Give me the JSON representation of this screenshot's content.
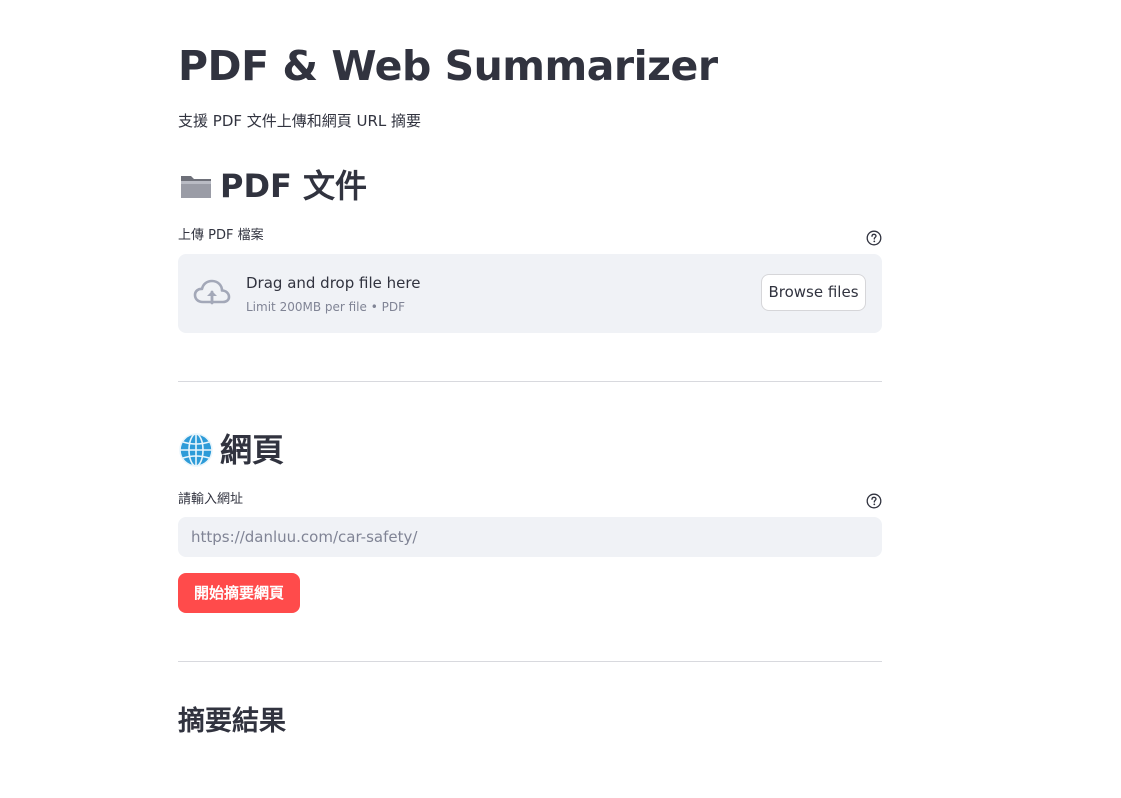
{
  "app": {
    "title": "PDF & Web Summarizer",
    "subtitle": "支援 PDF 文件上傳和網頁 URL 摘要"
  },
  "pdf_section": {
    "header": "PDF 文件",
    "icon": "folder-icon",
    "upload_label": "上傳 PDF 檔案",
    "dropzone": {
      "title": "Drag and drop file here",
      "limit": "Limit 200MB per file • PDF",
      "browse_label": "Browse files"
    }
  },
  "web_section": {
    "header": "網頁",
    "icon": "globe-icon",
    "url_label": "請輸入網址",
    "url_value": "",
    "url_placeholder": "https://danluu.com/car-safety/",
    "submit_label": "開始摘要網頁"
  },
  "result_section": {
    "header": "摘要結果"
  },
  "colors": {
    "primary": "#ff4b4b",
    "text": "#31333f",
    "muted": "#808495",
    "surface": "#f0f2f6"
  }
}
